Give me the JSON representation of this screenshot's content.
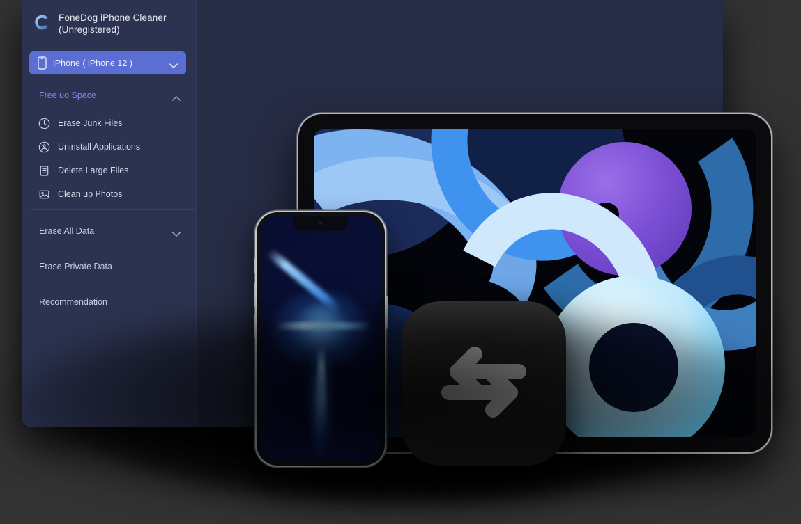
{
  "window": {
    "title": "FoneDog iPhone  Cleaner (Unregistered)",
    "brand_line_1": "FoneDog iPhone  Cleaner",
    "brand_line_2": "(Unregistered)",
    "logo_icon": "fonedog-c-logo-icon"
  },
  "colors": {
    "page_background": "#333333",
    "window_background": "#262c44",
    "sidebar_background": "#2c3350",
    "accent": "#7d8ce8",
    "device_button": "#5a6ed4",
    "text_primary": "#d8dced",
    "divider": "#39415f"
  },
  "device_selector": {
    "label": "iPhone ( iPhone 12 )",
    "device_icon": "phone-icon",
    "chevron_icon": "chevron-down-icon"
  },
  "sidebar": {
    "groups": [
      {
        "title": "Free uo Space",
        "expanded": true,
        "chevron_icon": "chevron-up-icon",
        "items": [
          {
            "label": "Erase Junk Files",
            "icon": "clock-icon"
          },
          {
            "label": "Uninstall Applications",
            "icon": "app-uninstall-icon"
          },
          {
            "label": "Delete Large Files",
            "icon": "document-icon"
          },
          {
            "label": "Clean up Photos",
            "icon": "photo-icon"
          }
        ]
      },
      {
        "title": "Erase All Data",
        "expanded": false,
        "chevron_icon": "chevron-down-icon",
        "items": []
      },
      {
        "title": "Erase Private Data",
        "expanded": false,
        "chevron_icon": "",
        "items": []
      },
      {
        "title": "Recommendation",
        "expanded": false,
        "chevron_icon": "",
        "items": []
      }
    ]
  },
  "showcase": {
    "tablet": {
      "name": "ipad-mockup",
      "wallpaper": "abstract-blue-ribbons-wallpaper"
    },
    "phone": {
      "name": "iphone-mockup",
      "wallpaper": "blue-light-streaks-wallpaper"
    },
    "app_icon": {
      "name": "phone-transfer-app-icon",
      "glyph": "bidirectional-arrows-icon"
    }
  }
}
